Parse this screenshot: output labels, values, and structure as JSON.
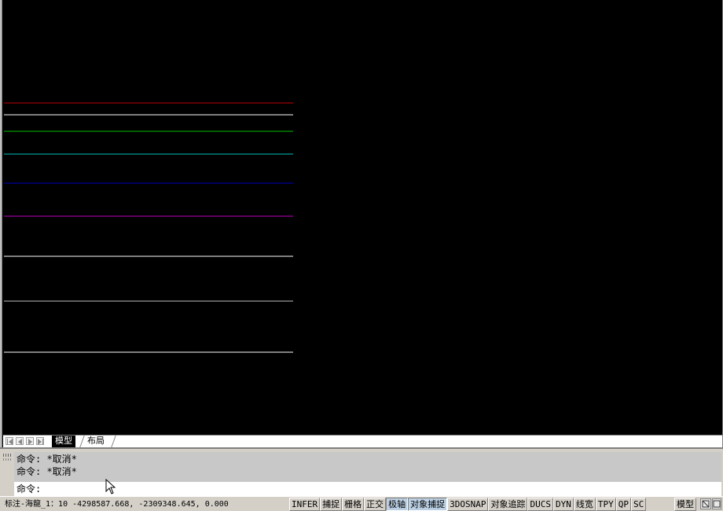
{
  "canvas": {
    "background": "#000000",
    "lines": [
      {
        "color": "#c00000"
      },
      {
        "color": "#ffffff"
      },
      {
        "color": "#00c000"
      },
      {
        "color": "#00c0c0"
      },
      {
        "color": "#0000c0"
      },
      {
        "color": "#c000c0"
      },
      {
        "color": "#ffffff"
      },
      {
        "color": "#c0c0c0"
      },
      {
        "color": "#ffffff"
      }
    ]
  },
  "tabs": {
    "nav_icons": [
      "first-icon",
      "prev-icon",
      "next-icon",
      "last-icon"
    ],
    "model": "模型",
    "layout": "布局"
  },
  "command": {
    "history": [
      "命令: *取消*",
      "命令: *取消*"
    ],
    "prompt": "命令:",
    "input_value": ""
  },
  "status": {
    "coords": "标注-海龍_1：10  -4298587.668, -2309348.645, 0.000",
    "toggles": [
      {
        "label": "INFER",
        "on": false
      },
      {
        "label": "捕捉",
        "on": false
      },
      {
        "label": "栅格",
        "on": false
      },
      {
        "label": "正交",
        "on": false
      },
      {
        "label": "极轴",
        "on": true
      },
      {
        "label": "对象捕捉",
        "on": true
      },
      {
        "label": "3DOSNAP",
        "on": false
      },
      {
        "label": "对象追踪",
        "on": false
      },
      {
        "label": "DUCS",
        "on": false
      },
      {
        "label": "DYN",
        "on": false
      },
      {
        "label": "线宽",
        "on": false
      },
      {
        "label": "TPY",
        "on": false
      },
      {
        "label": "QP",
        "on": false
      },
      {
        "label": "SC",
        "on": false
      }
    ],
    "model_button": "模型",
    "icons": [
      "layout-icon",
      "viewport-icon"
    ],
    "accent_on": "#bcd0e4"
  }
}
